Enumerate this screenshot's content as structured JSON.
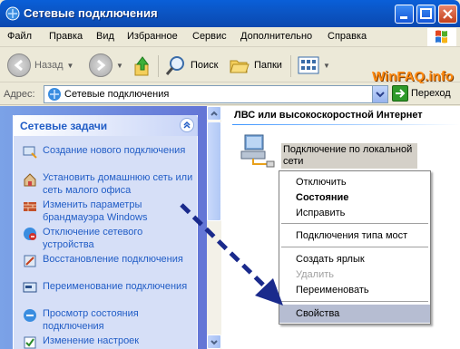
{
  "window": {
    "title": "Сетевые подключения"
  },
  "menu": [
    "Файл",
    "Правка",
    "Вид",
    "Избранное",
    "Сервис",
    "Дополнительно",
    "Справка"
  ],
  "toolbar": {
    "back": "Назад",
    "search": "Поиск",
    "folders": "Папки"
  },
  "watermark": "WinFAQ.info",
  "address": {
    "label": "Адрес:",
    "value": "Сетевые подключения",
    "go": "Переход"
  },
  "tasks": {
    "header": "Сетевые задачи",
    "items": [
      {
        "label": "Создание нового подключения",
        "icon": "new-connection-icon"
      },
      {
        "label": "Установить домашнюю сеть или сеть малого офиса",
        "icon": "home-network-icon"
      },
      {
        "label": "Изменить параметры брандмауэра Windows",
        "icon": "firewall-icon"
      },
      {
        "label": "Отключение сетевого устройства",
        "icon": "disable-device-icon"
      },
      {
        "label": "Восстановление подключения",
        "icon": "repair-icon"
      },
      {
        "label": "Переименование подключения",
        "icon": "rename-icon"
      },
      {
        "label": "Просмотр состояния подключения",
        "icon": "status-icon"
      },
      {
        "label": "Изменение настроек",
        "icon": "settings-icon"
      }
    ]
  },
  "content": {
    "section": "ЛВС или высокоскоростной Интернет",
    "connection": "Подключение по локальной сети"
  },
  "context_menu": {
    "items": [
      "Отключить",
      "Состояние",
      "Исправить",
      "Подключения типа мост",
      "Создать ярлык",
      "Удалить",
      "Переименовать",
      "Свойства"
    ]
  },
  "colors": {
    "title_bar": "#0a55c8",
    "task_link": "#215dc6",
    "menu_highlight": "#b6bdd2",
    "arrow": "#1a2a8c"
  }
}
